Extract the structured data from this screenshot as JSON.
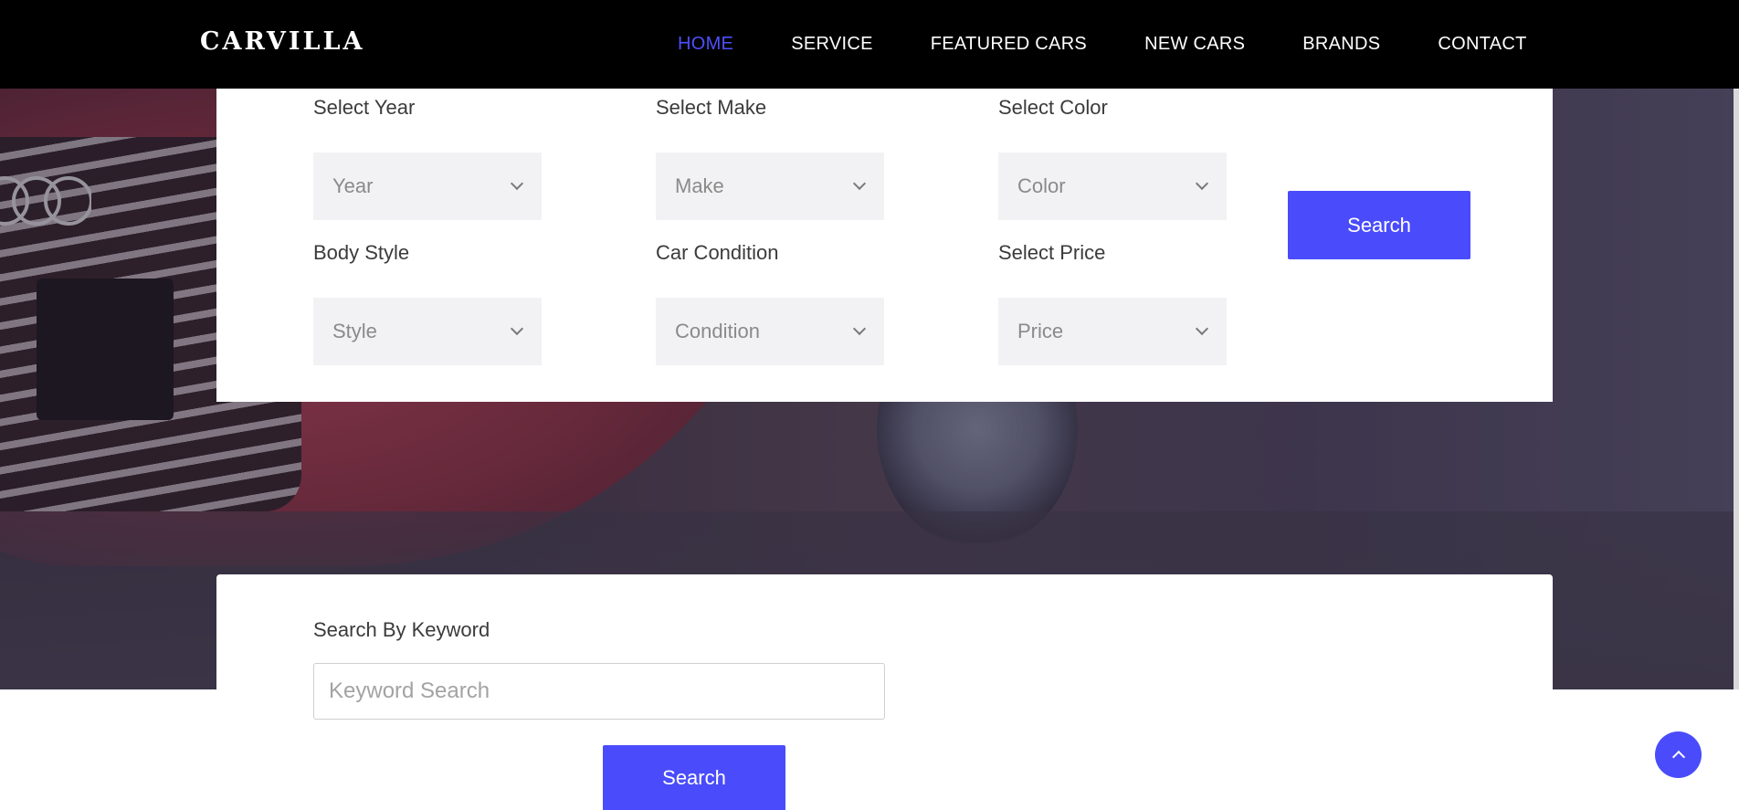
{
  "brand": "CARVILLA",
  "nav": {
    "items": [
      "HOME",
      "SERVICE",
      "FEATURED CARS",
      "NEW CARS",
      "BRANDS",
      "CONTACT"
    ],
    "active": "HOME"
  },
  "filters": {
    "year": {
      "label": "Select Year",
      "value": "Year"
    },
    "make": {
      "label": "Select Make",
      "value": "Make"
    },
    "color": {
      "label": "Select Color",
      "value": "Color"
    },
    "style": {
      "label": "Body Style",
      "value": "Style"
    },
    "condition": {
      "label": "Car Condition",
      "value": "Condition"
    },
    "price": {
      "label": "Select Price",
      "value": "Price"
    },
    "search_label": "Search"
  },
  "keyword": {
    "label": "Search By Keyword",
    "placeholder": "Keyword Search",
    "value": "",
    "search_label": "Search"
  },
  "colors": {
    "accent": "#4a4cfb",
    "nav_bg": "#000000",
    "active_nav": "#4e4ffa"
  },
  "icons": {
    "dropdown": "chevron-down-icon",
    "scroll_top": "chevron-up-icon"
  }
}
